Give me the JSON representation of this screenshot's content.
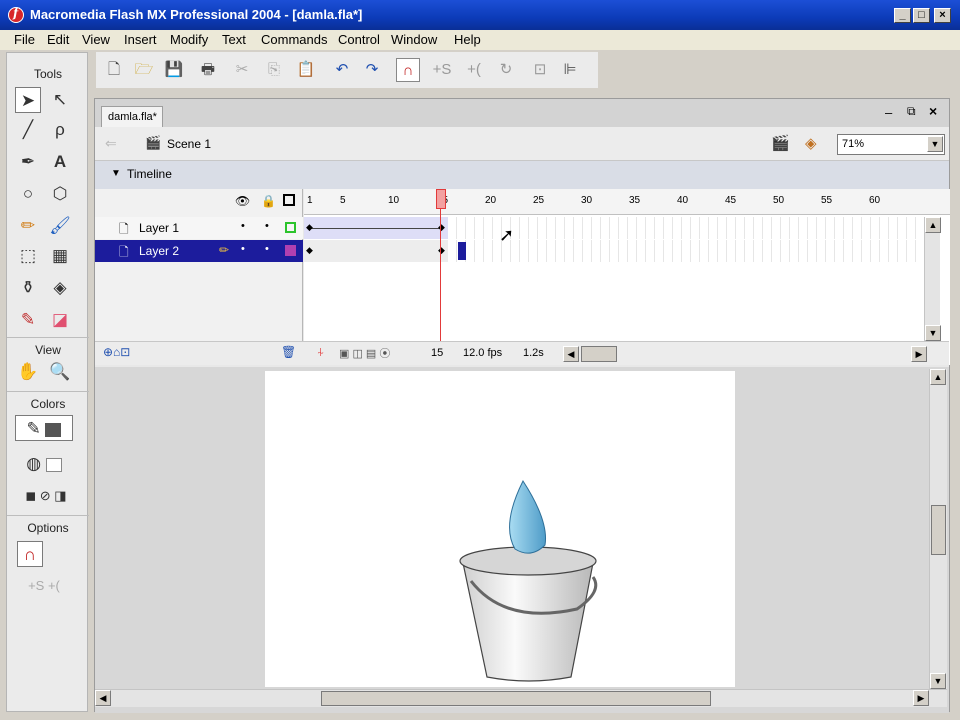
{
  "window": {
    "title": "Macromedia Flash MX Professional 2004 - [damla.fla*]"
  },
  "menu": [
    "File",
    "Edit",
    "View",
    "Insert",
    "Modify",
    "Text",
    "Commands",
    "Control",
    "Window",
    "Help"
  ],
  "tools_panel": {
    "tools_label": "Tools",
    "view_label": "View",
    "colors_label": "Colors",
    "options_label": "Options"
  },
  "document": {
    "tab": "damla.fla*",
    "scene": "Scene 1",
    "zoom": "71%",
    "timeline_label": "Timeline",
    "frame_numbers": [
      "1",
      "5",
      "10",
      "15",
      "20",
      "25",
      "30",
      "35",
      "40",
      "45",
      "50",
      "55",
      "60"
    ],
    "layers": [
      {
        "name": "Layer 1",
        "color": "#2cc42c"
      },
      {
        "name": "Layer 2",
        "color": "#b040b0"
      }
    ],
    "status": {
      "current_frame": "15",
      "fps": "12.0 fps",
      "time": "1.2s"
    }
  },
  "colors": {
    "accent_selection": "#1c1c9c",
    "playhead": "#e23a3a",
    "drop": "#7cc4e8"
  }
}
